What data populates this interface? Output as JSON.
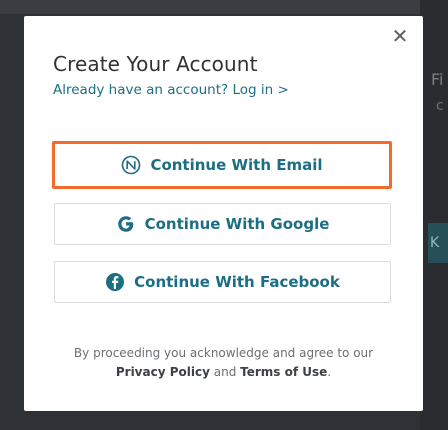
{
  "background": {
    "right_text_1": "Fi",
    "right_text_2": "c",
    "right_badge": "K"
  },
  "modal": {
    "close_symbol": "✕",
    "title": "Create Your Account",
    "subtitle_prefix": "Already have an account?",
    "login_link": "Log in >",
    "buttons": {
      "email": {
        "label": "Continue With Email",
        "icon": "email-circle-icon"
      },
      "google": {
        "label": "Continue With Google",
        "icon": "google-icon"
      },
      "facebook": {
        "label": "Continue With Facebook",
        "icon": "facebook-icon"
      }
    },
    "terms": {
      "line1": "By proceeding you acknowledge and agree to our",
      "privacy_link": "Privacy Policy",
      "and": "and",
      "terms_link": "Terms of Use",
      "period": "."
    }
  },
  "colors": {
    "accent": "#1b6e83",
    "highlight_border": "#f26b2a",
    "text": "#2f3337"
  }
}
